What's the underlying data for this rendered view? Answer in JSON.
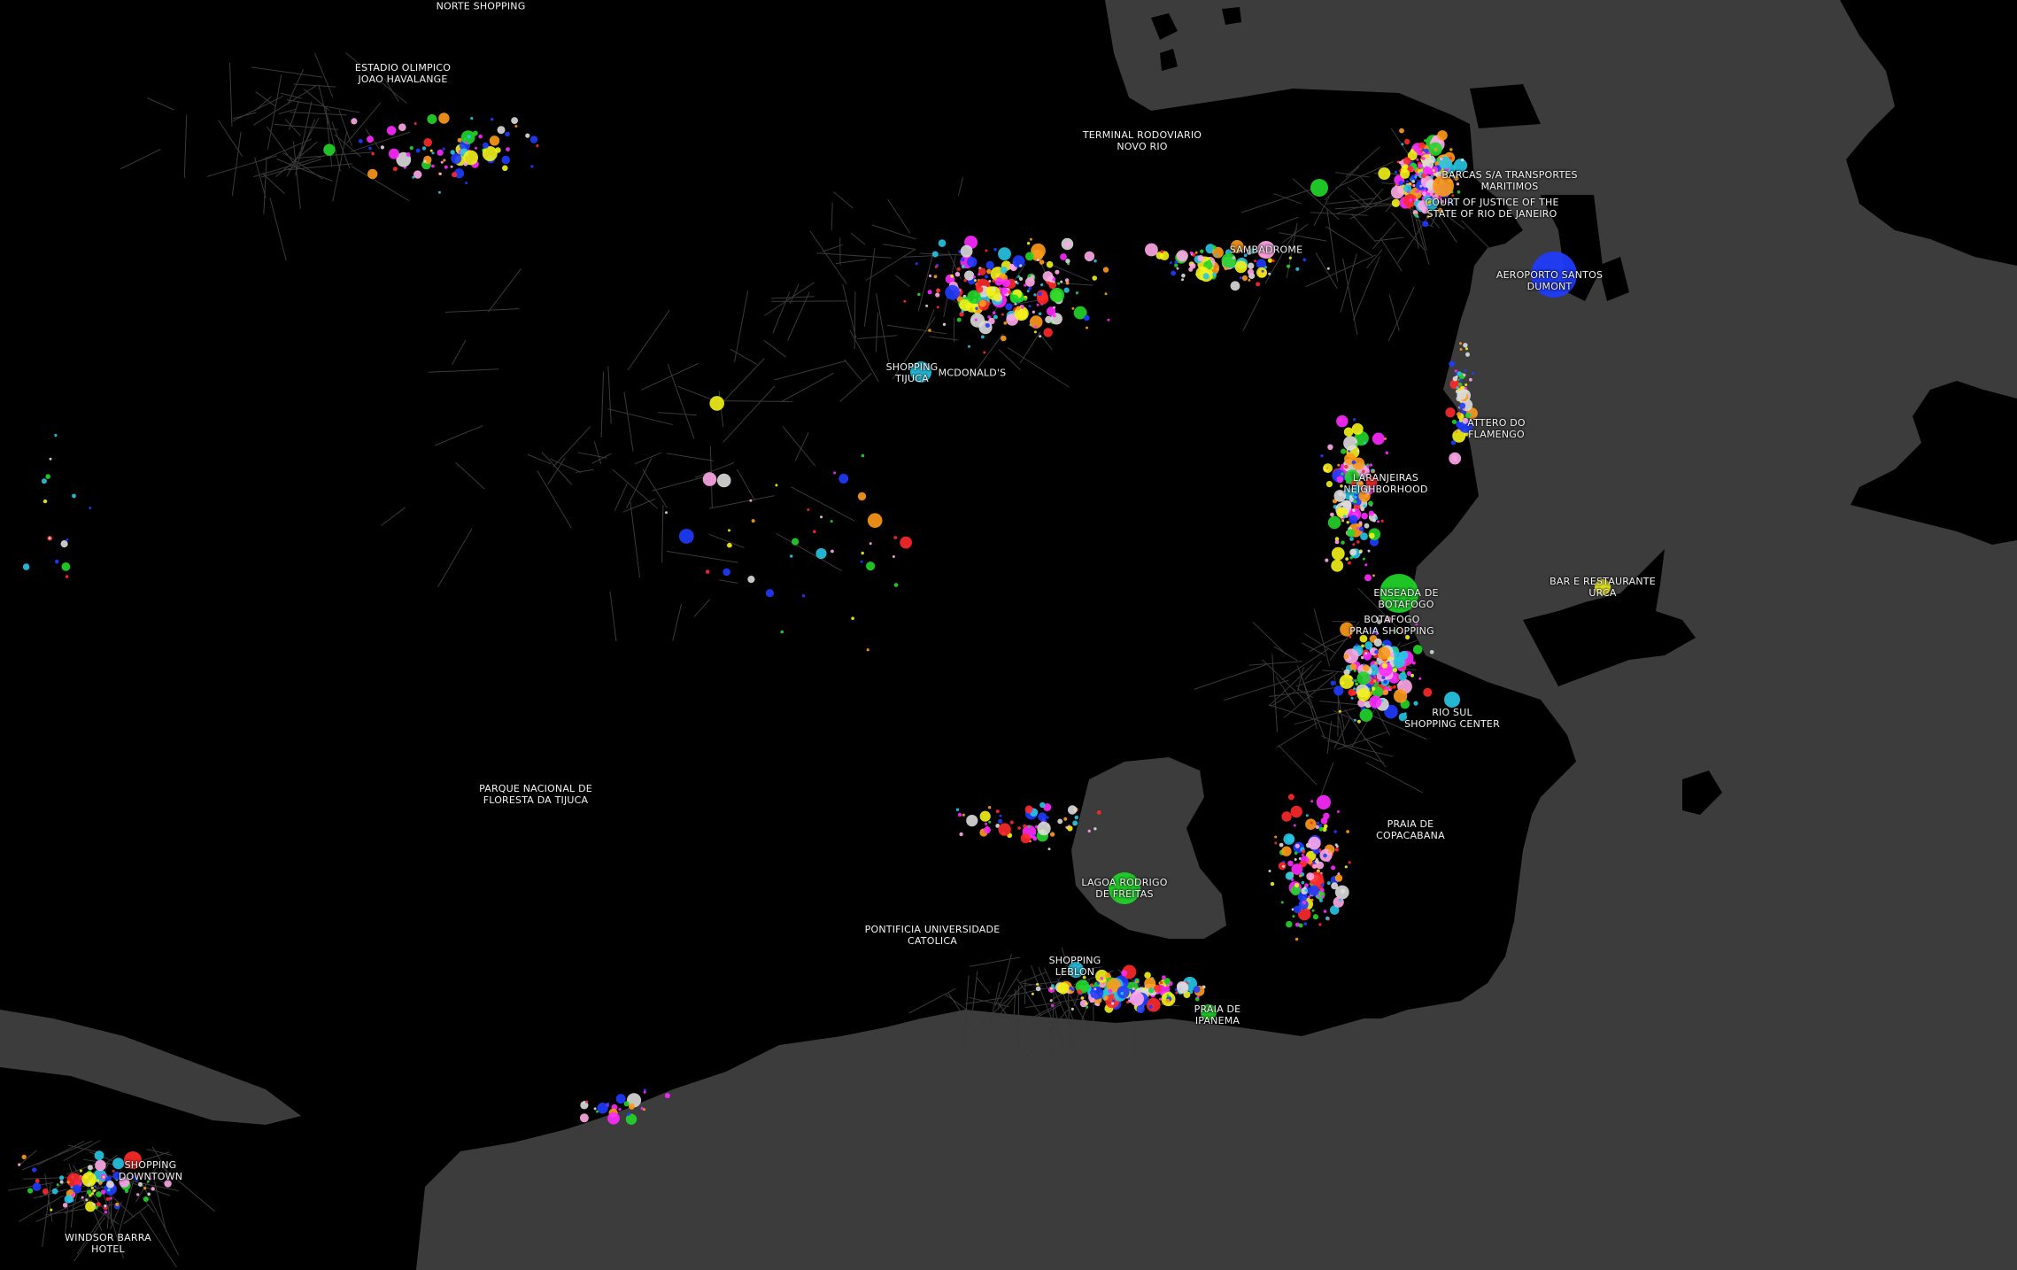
{
  "map": {
    "water_color": "#3c3c3c",
    "land_color": "#000000",
    "road_color": "#3a3a3a",
    "category_colors": {
      "red": "#ff2a2a",
      "yellow": "#f2f21a",
      "green": "#22d62a",
      "blue": "#1f3cff",
      "cyan": "#27c7e6",
      "magenta": "#ff2aff",
      "pink": "#ffa8e8",
      "white": "#dcdcdc",
      "orange": "#ff9a1a"
    }
  },
  "labels": {
    "norte_shopping": "NORTE SHOPPING",
    "estadio_olimpico": "ESTADIO OLIMPICO\nJOAO HAVALANGE",
    "terminal_rodoviario": "TERMINAL RODOVIARIO\nNOVO RIO",
    "barcas": "BARCAS S/A TRANSPORTES\nMARITIMOS",
    "court_of_justice": "COURT OF JUSTICE OF THE\nSTATE OF RIO DE JANEIRO",
    "sambadrome": "SAMBADROME",
    "aeroporto": "AEROPORTO SANTOS\nDUMONT",
    "shopping_tijuca": "SHOPPING\nTIJUCA",
    "mcdonalds": "MCDONALD'S",
    "attero": "ATTERO DO\nFLAMENGO",
    "laranjeiras": "LARANJEIRAS\nNEIGHBORHOOD",
    "bar_restaurante": "BAR E RESTAURANTE\nURCA",
    "enseada": "ENSEADA DE\nBOTAFOGO",
    "botafogo_praia": "BOTAFOGO\nPRAIA SHOPPING",
    "rio_sul": "RIO SUL\nSHOPPING CENTER",
    "parque_nacional": "PARQUE NACIONAL DE\nFLORESTA DA TIJUCA",
    "copacabana": "PRAIA DE\nCOPACABANA",
    "lagoa": "LAGOA RODRIGO\nDE FREITAS",
    "pontificia": "PONTIFICIA UNIVERSIDADE\nCATOLICA",
    "shopping_leblon": "SHOPPING\nLEBLON",
    "ipanema": "PRAIA DE\nIPANEMA",
    "shopping_downtown": "SHOPPING\nDOWNTOWN",
    "windsor": "WINDSOR BARRA\nHOTEL"
  }
}
